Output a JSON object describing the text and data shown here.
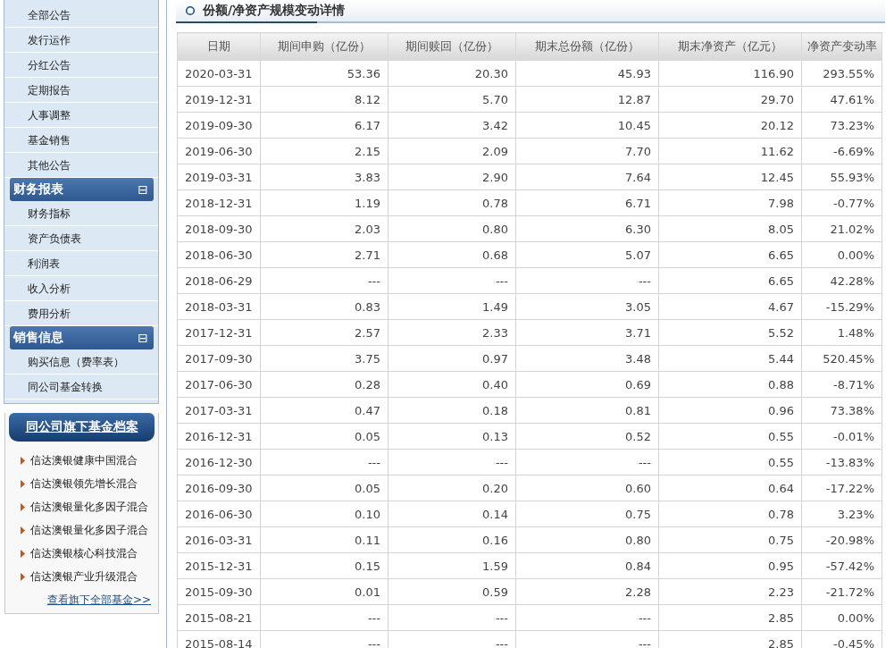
{
  "sidebar": {
    "groups": [
      {
        "items": [
          "全部公告",
          "发行运作",
          "分红公告",
          "定期报告",
          "人事调整",
          "基金销售",
          "其他公告"
        ]
      },
      {
        "title": "财务报表",
        "toggle": "⊟",
        "expanded": true,
        "items": [
          "财务指标",
          "资产负债表",
          "利润表",
          "收入分析",
          "费用分析"
        ]
      },
      {
        "title": "销售信息",
        "toggle": "⊟",
        "expanded": true,
        "items": [
          "购买信息（费率表）",
          "同公司基金转换"
        ]
      }
    ]
  },
  "fund_archive": {
    "title": "同公司旗下基金档案",
    "funds": [
      "信达澳银健康中国混合",
      "信达澳银领先增长混合",
      "信达澳银量化多因子混合",
      "信达澳银量化多因子混合",
      "信达澳银核心科技混合",
      "信达澳银产业升级混合"
    ],
    "more_link": "查看旗下全部基金>>"
  },
  "section": {
    "title": "份额/净资产规模变动详情"
  },
  "table": {
    "columns": [
      "日期",
      "期间申购（亿份）",
      "期间赎回（亿份）",
      "期末总份额（亿份）",
      "期末净资产（亿元）",
      "净资产变动率"
    ],
    "rows": [
      [
        "2020-03-31",
        "53.36",
        "20.30",
        "45.93",
        "116.90",
        "293.55%"
      ],
      [
        "2019-12-31",
        "8.12",
        "5.70",
        "12.87",
        "29.70",
        "47.61%"
      ],
      [
        "2019-09-30",
        "6.17",
        "3.42",
        "10.45",
        "20.12",
        "73.23%"
      ],
      [
        "2019-06-30",
        "2.15",
        "2.09",
        "7.70",
        "11.62",
        "-6.69%"
      ],
      [
        "2019-03-31",
        "3.83",
        "2.90",
        "7.64",
        "12.45",
        "55.93%"
      ],
      [
        "2018-12-31",
        "1.19",
        "0.78",
        "6.71",
        "7.98",
        "-0.77%"
      ],
      [
        "2018-09-30",
        "2.03",
        "0.80",
        "6.30",
        "8.05",
        "21.02%"
      ],
      [
        "2018-06-30",
        "2.71",
        "0.68",
        "5.07",
        "6.65",
        "0.00%"
      ],
      [
        "2018-06-29",
        "---",
        "---",
        "---",
        "6.65",
        "42.28%"
      ],
      [
        "2018-03-31",
        "0.83",
        "1.49",
        "3.05",
        "4.67",
        "-15.29%"
      ],
      [
        "2017-12-31",
        "2.57",
        "2.33",
        "3.71",
        "5.52",
        "1.48%"
      ],
      [
        "2017-09-30",
        "3.75",
        "0.97",
        "3.48",
        "5.44",
        "520.45%"
      ],
      [
        "2017-06-30",
        "0.28",
        "0.40",
        "0.69",
        "0.88",
        "-8.71%"
      ],
      [
        "2017-03-31",
        "0.47",
        "0.18",
        "0.81",
        "0.96",
        "73.38%"
      ],
      [
        "2016-12-31",
        "0.05",
        "0.13",
        "0.52",
        "0.55",
        "-0.01%"
      ],
      [
        "2016-12-30",
        "---",
        "---",
        "---",
        "0.55",
        "-13.83%"
      ],
      [
        "2016-09-30",
        "0.05",
        "0.20",
        "0.60",
        "0.64",
        "-17.22%"
      ],
      [
        "2016-06-30",
        "0.10",
        "0.14",
        "0.75",
        "0.78",
        "3.23%"
      ],
      [
        "2016-03-31",
        "0.11",
        "0.16",
        "0.80",
        "0.75",
        "-20.98%"
      ],
      [
        "2015-12-31",
        "0.15",
        "1.59",
        "0.84",
        "0.95",
        "-57.42%"
      ],
      [
        "2015-09-30",
        "0.01",
        "0.59",
        "2.28",
        "2.23",
        "-21.72%"
      ],
      [
        "2015-08-21",
        "---",
        "---",
        "---",
        "2.85",
        "0.00%"
      ],
      [
        "2015-08-14",
        "---",
        "---",
        "---",
        "2.85",
        "-0.45%"
      ]
    ]
  }
}
